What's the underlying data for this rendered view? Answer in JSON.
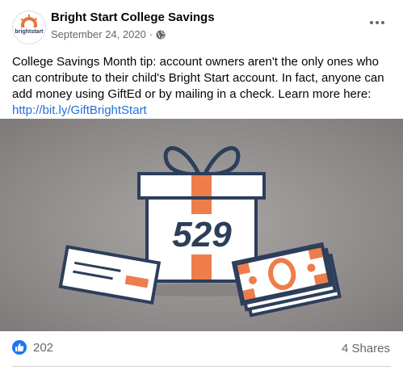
{
  "post": {
    "page_name": "Bright Start College Savings",
    "date": "September 24, 2020",
    "separator": "·",
    "audience_icon": "globe-icon",
    "more_icon": "more-options-icon",
    "avatar": {
      "logo_text": "brightstart",
      "accent": "#e8733a"
    },
    "text_body": "College Savings Month tip: account owners aren't the only ones who can contribute to their child's Bright Start account. In fact, anyone can add money using GiftEd or by mailing in a check. Learn more here: ",
    "link": "http://bit.ly/GiftBrightStart",
    "image": {
      "gift_label": "529",
      "colors": {
        "background": "#8c8888",
        "accent": "#ee7d4b",
        "outline": "#2c3e5a",
        "paper": "#ffffff"
      }
    },
    "reaction_icon": "like-icon",
    "reaction_count": "202",
    "shares": "4 Shares"
  }
}
